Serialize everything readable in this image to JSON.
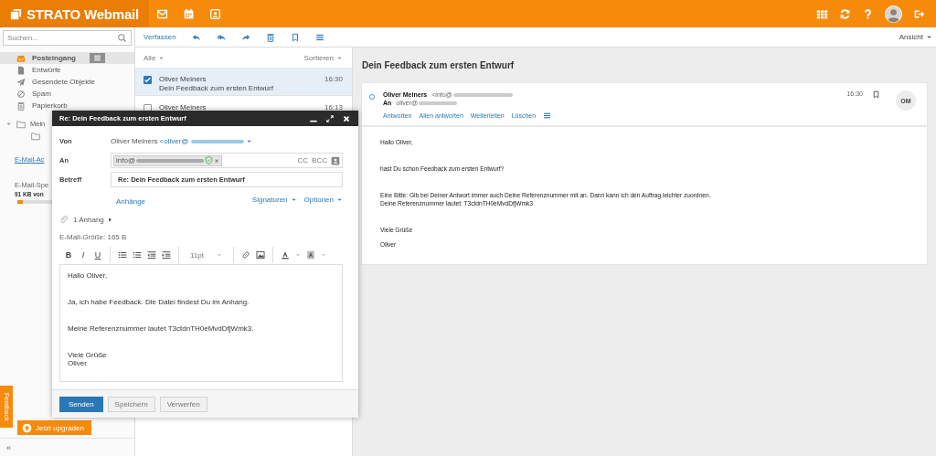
{
  "header": {
    "logo": "STRATO Webmail"
  },
  "sidebar": {
    "search": {
      "placeholder": "Suchen..."
    },
    "folders": [
      {
        "label": "Posteingang",
        "kind": "inbox",
        "selected": true
      },
      {
        "label": "Entwürfe",
        "kind": "drafts",
        "selected": false
      },
      {
        "label": "Gesendete Objekte",
        "kind": "sent",
        "selected": false
      },
      {
        "label": "Spam",
        "kind": "spam",
        "selected": false
      },
      {
        "label": "Papierkorb",
        "kind": "trash",
        "selected": false
      }
    ],
    "custom_folder": "Mein",
    "account_link": "E-Mail-Ac",
    "storage": {
      "label": "E-Mail-Spe",
      "usage": "91 KB von",
      "level": 0.05
    },
    "upgrade": "Jetzt upgraden",
    "feedback": "Feedback",
    "collapse": "«"
  },
  "toolbar": {
    "compose": "Verfassen",
    "view": "Ansicht"
  },
  "list": {
    "filter": "Alle",
    "sort": "Sortieren",
    "messages": [
      {
        "sender": "Oliver Meiners",
        "subject": "Dein Feedback zum ersten Entwurf",
        "time": "16:30",
        "selected": true
      },
      {
        "sender": "Oliver Meiners",
        "time": "16:13",
        "selected": false
      }
    ]
  },
  "reading": {
    "title": "Dein Feedback zum ersten Entwurf",
    "sender": "Oliver Meiners",
    "sender_address": "<info@",
    "to_label": "An",
    "to_address": "oliver@",
    "time": "16:30",
    "initials": "OM",
    "actions": [
      "Antworten",
      "Allen antworten",
      "Weiterleiten",
      "Löschen"
    ],
    "body": [
      "Hallo Oliver,",
      "hast Du schon Feedback zum ersten Entwurf?",
      "Eine Bitte: Gib bei Deiner Antwort immer auch Deine Referenznummer mit an. Dann kann ich den Auftrag leichter zuordnen. Deine Referenznummer lautet: T3ctdnTH0eMvdDfjWmk3",
      "Viele Grüße",
      "Oliver"
    ]
  },
  "compose": {
    "title": "Re: Dein Feedback zum ersten Entwurf",
    "from_label": "Von",
    "from_name": "Oliver Meiners",
    "from_address": "<oliver@",
    "to_label": "An",
    "recipient": "info@",
    "cc": "CC",
    "bcc": "BCC",
    "subject_label": "Betreff",
    "subject": "Re: Dein Feedback zum ersten Entwurf",
    "attachments_link": "Anhänge",
    "signatures": "Signaturen",
    "options": "Optionen",
    "attachment_count": "1 Anhang",
    "size": "E-Mail-Größe: 165 B",
    "format_buttons": [
      "B",
      "I",
      "U"
    ],
    "font_size": "11pt",
    "body": [
      [
        "Hallo Oliver,"
      ],
      [
        "Ja, ich habe Feedback. Die Datei findest Du im Anhang."
      ],
      [
        "Meine Referenznummer lautet T3ctdnTH0eMvdDfjWmk3."
      ],
      [
        "Viele Grüße",
        "Oliver"
      ]
    ],
    "buttons": [
      {
        "label": "Senden",
        "kind": "primary"
      },
      {
        "label": "Speichern",
        "kind": "secondary"
      },
      {
        "label": "Verwerfen",
        "kind": "secondary"
      }
    ]
  }
}
